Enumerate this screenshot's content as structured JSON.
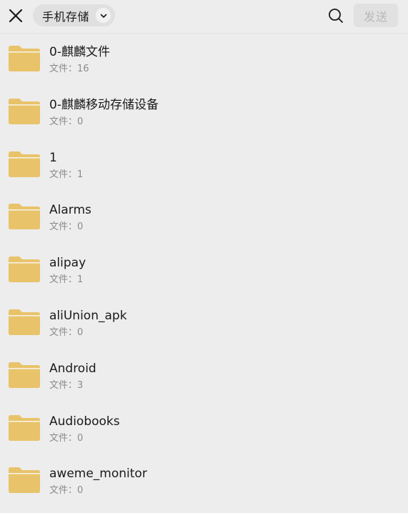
{
  "header": {
    "storage_label": "手机存储",
    "send_label": "发送",
    "icons": {
      "close": "close-icon",
      "dropdown": "chevron-down-icon",
      "search": "search-icon"
    }
  },
  "colors": {
    "background": "#ededed",
    "folder": "#e8c36a",
    "send_disabled_bg": "#e1e1e1",
    "send_disabled_text": "#b8b8b8"
  },
  "files": [
    {
      "name": "0-麒麟文件",
      "count": "文件：16"
    },
    {
      "name": "0-麒麟移动存储设备",
      "count": "文件：0"
    },
    {
      "name": "1",
      "count": "文件：1"
    },
    {
      "name": "Alarms",
      "count": "文件：0"
    },
    {
      "name": "alipay",
      "count": "文件：1"
    },
    {
      "name": "aliUnion_apk",
      "count": "文件：0"
    },
    {
      "name": "Android",
      "count": "文件：3"
    },
    {
      "name": "Audiobooks",
      "count": "文件：0"
    },
    {
      "name": "aweme_monitor",
      "count": "文件：0"
    }
  ]
}
